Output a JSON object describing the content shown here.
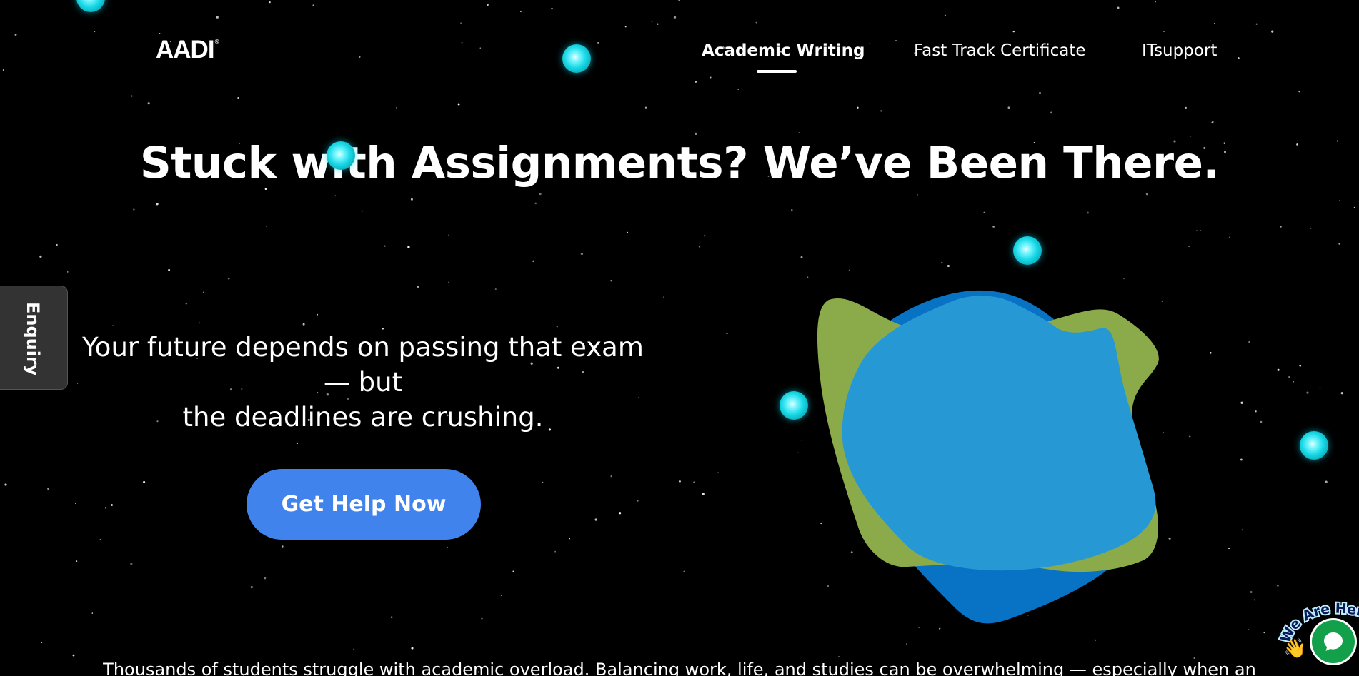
{
  "brand": {
    "logo_text": "AADI",
    "registered_mark": "®"
  },
  "nav": {
    "items": [
      {
        "label": "Academic Writing",
        "active": true
      },
      {
        "label": "Fast Track Certificate",
        "active": false
      },
      {
        "label": "ITsupport",
        "active": false
      }
    ]
  },
  "hero": {
    "headline": "Stuck with Assignments? We’ve Been There.",
    "subtext_lines": [
      "Your future depends on passing that exam",
      "— but",
      "the deadlines are crushing."
    ],
    "cta_label": "Get Help Now"
  },
  "sidebar": {
    "enquiry_label": "Enquiry"
  },
  "bottom_text": "Thousands of students struggle with academic overload. Balancing work, life, and studies can be overwhelming — especially when an",
  "chat_widget": {
    "badge_text": "We Are Here",
    "icon": "chat-bubble-icon",
    "emoji": "👋"
  },
  "colors": {
    "background": "#000000",
    "accent_button": "#4183ec",
    "orb": "#18d9e6",
    "blob_green": "#8bab4b",
    "blob_blue_dark": "#0872c4",
    "blob_blue_light": "#2698d4",
    "chat_green": "#12a04a"
  }
}
